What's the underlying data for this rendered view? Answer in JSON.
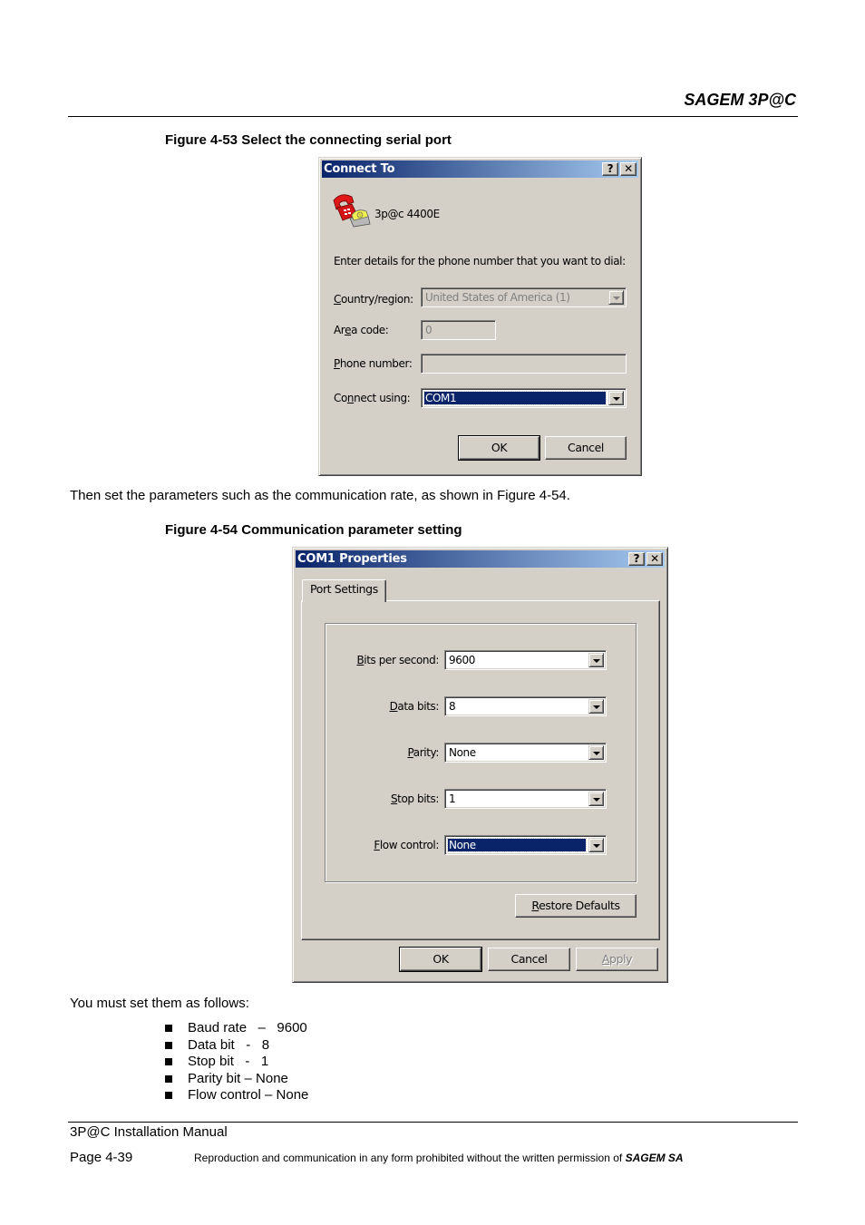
{
  "page": {
    "header_title": "SAGEM 3P@C",
    "figure1_caption": "Figure 4-53 Select the connecting serial port",
    "paragraph1": "Then set the parameters such as the communication rate, as shown in Figure 4-54.",
    "figure2_caption": "Figure 4-54 Communication parameter setting",
    "paragraph2": "You must set them as follows:",
    "settings_list": [
      "Baud rate   –   9600",
      "Data bit   -   8",
      "Stop bit   -   1",
      "Parity bit – None",
      "Flow control – None"
    ],
    "footer": {
      "manual_title": "3P@C Installation Manual",
      "page_number": "Page 4-39",
      "notice": "Reproduction and communication in any form prohibited without the written permission of ",
      "notice_company": "SAGEM SA"
    }
  },
  "connect_dialog": {
    "title": "Connect To",
    "help_button": "?",
    "close_button": "✕",
    "connection_icon": "telephone-icon",
    "connection_name": "3p@c 4400E",
    "instruction": "Enter details for the phone number that you want to dial:",
    "country_label_u": "C",
    "country_label_rest": "ountry/region:",
    "country_value": "United States of America (1)",
    "area_label_pre": "Ar",
    "area_label_u": "e",
    "area_label_rest": "a code:",
    "area_value": "0",
    "phone_label_u": "P",
    "phone_label_rest": "hone number:",
    "phone_value": "",
    "connect_label_pre": "Co",
    "connect_label_u": "n",
    "connect_label_rest": "nect using:",
    "connect_value": "COM1",
    "ok_label": "OK",
    "cancel_label": "Cancel"
  },
  "com1_dialog": {
    "title": "COM1 Properties",
    "help_button": "?",
    "close_button": "✕",
    "tab_label": "Port Settings",
    "fields": [
      {
        "label_u": "B",
        "label_rest": "its per second:",
        "value": "9600"
      },
      {
        "label_u": "D",
        "label_rest": "ata bits:",
        "value": "8"
      },
      {
        "label_u": "P",
        "label_rest": "arity:",
        "value": "None"
      },
      {
        "label_u": "S",
        "label_rest": "top bits:",
        "value": "1"
      },
      {
        "label_u": "F",
        "label_rest": "low control:",
        "value": "None"
      }
    ],
    "restore_u": "R",
    "restore_rest": "estore Defaults",
    "ok_label": "OK",
    "cancel_label": "Cancel",
    "apply_u": "A",
    "apply_rest": "pply"
  }
}
